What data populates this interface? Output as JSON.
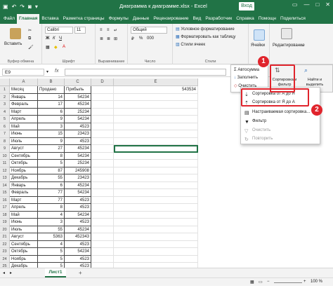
{
  "titlebar": {
    "filename": "Диаграмма к диаграмме.xlsx - Excel",
    "signin": "Вход",
    "qa_icons": [
      "save-icon",
      "undo-icon",
      "redo-icon",
      "camera-icon",
      "customize-icon"
    ]
  },
  "tabs": [
    "Файл",
    "Главная",
    "Вставка",
    "Разметка страницы",
    "Формулы",
    "Данные",
    "Рецензирование",
    "Вид",
    "Разработчик",
    "Справка",
    "Помощн",
    "Поделиться"
  ],
  "active_tab": "Главная",
  "ribbon": {
    "clipboard": {
      "paste_label": "Вставить",
      "group": "Буфер обмена"
    },
    "font": {
      "family": "Calibri",
      "size": "11",
      "group": "Шрифт",
      "bold": "Ж",
      "italic": "К",
      "underline": "Ч"
    },
    "alignment": {
      "group": "Выравнивание"
    },
    "number": {
      "format": "Общий",
      "group": "Число",
      "percent": "%",
      "thousands": "000"
    },
    "styles": {
      "group": "Стили",
      "conditional": "Условное форматирование",
      "table": "Форматировать как таблицу",
      "cell_styles": "Стили ячеек"
    },
    "cells": {
      "label": "Ячейки"
    },
    "editing": {
      "label": "Редактирование"
    }
  },
  "formula_bar": {
    "cell_ref": "E9",
    "fx": "fx",
    "value": ""
  },
  "columns": [
    "A",
    "B",
    "C",
    "D",
    "E"
  ],
  "table": {
    "headers": [
      "Месяц",
      "Продано",
      "Прибыль"
    ],
    "rows": [
      [
        "Январь",
        "14",
        "54234"
      ],
      [
        "Февраль",
        "17",
        "45234"
      ],
      [
        "Март",
        "6",
        "25234"
      ],
      [
        "Апрель",
        "9",
        "54234"
      ],
      [
        "Май",
        "3",
        "4523"
      ],
      [
        "Июнь",
        "15",
        "23423"
      ],
      [
        "Июль",
        "9",
        "4523"
      ],
      [
        "Август",
        "27",
        "45234"
      ],
      [
        "Сентябрь",
        "8",
        "54234"
      ],
      [
        "Октябрь",
        "5",
        "25234"
      ],
      [
        "Ноябрь",
        "87",
        "245908"
      ],
      [
        "Декабрь",
        "55",
        "23423"
      ],
      [
        "Январь",
        "6",
        "45234"
      ],
      [
        "Февраль",
        "77",
        "54234"
      ],
      [
        "Март",
        "77",
        "4523"
      ],
      [
        "Апрель",
        "8",
        "4523"
      ],
      [
        "Май",
        "4",
        "54234"
      ],
      [
        "Июнь",
        "3",
        "4523"
      ],
      [
        "Июль",
        "55",
        "45234"
      ],
      [
        "Август",
        "5363",
        "452343"
      ],
      [
        "Сентябрь",
        "4",
        "4523"
      ],
      [
        "Октябрь",
        "5",
        "54234"
      ],
      [
        "Ноябрь",
        "5",
        "4523"
      ],
      [
        "Декабрь",
        "5",
        "4523"
      ]
    ],
    "e1_value": "543534"
  },
  "menu_editing": {
    "autosum": "Автосумма",
    "fill": "Заполнить",
    "clear": "Очистить",
    "sort_filter": "Сортировка и фильтр",
    "find_select": "Найти и выделить"
  },
  "sort_menu": {
    "sort_asc": "Сортировка от А до Я",
    "sort_desc": "Сортировка от Я до А",
    "custom": "Настраиваемая сортировка...",
    "filter": "Фильтр",
    "clear": "Очистить",
    "reapply": "Повторить"
  },
  "badges": [
    "1",
    "2"
  ],
  "sheet": {
    "tab": "Лист1",
    "add": "+"
  },
  "status": {
    "zoom": "100 %"
  },
  "accent": "#217346",
  "highlight": "#e0242c"
}
